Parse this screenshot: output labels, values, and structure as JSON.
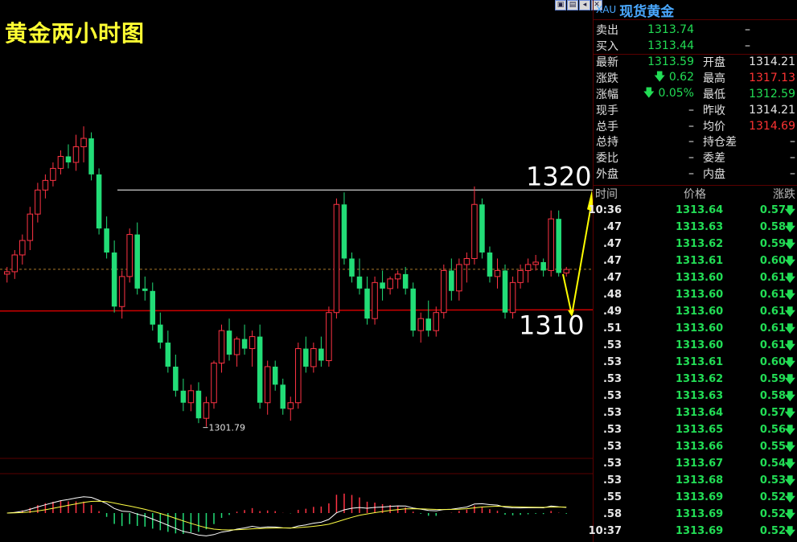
{
  "chart_title": "黄金两小时图",
  "toolbar": {
    "buttons": [
      "window-icon",
      "chart-icon",
      "back-icon",
      "close-icon"
    ]
  },
  "annotations": {
    "level_high": "1320",
    "level_low": "1310",
    "min_marker": "1301.79"
  },
  "symbol": {
    "code": "XAU",
    "name": "现货黄金"
  },
  "quotes": {
    "sell_label": "卖出",
    "sell_value": "1313.74",
    "sell_vol": "–",
    "buy_label": "买入",
    "buy_value": "1313.44",
    "buy_vol": "–",
    "rows": [
      {
        "l1": "最新",
        "v1": "1313.59",
        "c1": "grn",
        "l2": "开盘",
        "v2": "1314.21",
        "c2": "wht"
      },
      {
        "l1": "涨跌",
        "v1": "🡇 0.62",
        "c1": "grn",
        "l2": "最高",
        "v2": "1317.13",
        "c2": "red"
      },
      {
        "l1": "涨幅",
        "v1": "🡇 0.05%",
        "c1": "grn",
        "l2": "最低",
        "v2": "1312.59",
        "c2": "grn"
      },
      {
        "l1": "现手",
        "v1": "–",
        "c1": "wht",
        "l2": "昨收",
        "v2": "1314.21",
        "c2": "wht"
      },
      {
        "l1": "总手",
        "v1": "–",
        "c1": "wht",
        "l2": "均价",
        "v2": "1314.69",
        "c2": "red"
      },
      {
        "l1": "总持",
        "v1": "–",
        "c1": "wht",
        "l2": "持仓差",
        "v2": "–",
        "c2": "wht"
      },
      {
        "l1": "委比",
        "v1": "–",
        "c1": "wht",
        "l2": "委差",
        "v2": "–",
        "c2": "wht"
      },
      {
        "l1": "外盘",
        "v1": "–",
        "c1": "wht",
        "l2": "内盘",
        "v2": "–",
        "c2": "wht"
      }
    ]
  },
  "trades_header": {
    "time": "时间",
    "price": "价格",
    "change": "涨跌"
  },
  "trades": [
    {
      "time": "10:36",
      "price": "1313.64",
      "change": "0.57"
    },
    {
      "time": ".47",
      "price": "1313.63",
      "change": "0.58"
    },
    {
      "time": ".47",
      "price": "1313.62",
      "change": "0.59"
    },
    {
      "time": ".47",
      "price": "1313.61",
      "change": "0.60"
    },
    {
      "time": ".47",
      "price": "1313.60",
      "change": "0.61"
    },
    {
      "time": ".48",
      "price": "1313.60",
      "change": "0.61"
    },
    {
      "time": ".49",
      "price": "1313.60",
      "change": "0.61"
    },
    {
      "time": ".51",
      "price": "1313.60",
      "change": "0.61"
    },
    {
      "time": ".53",
      "price": "1313.60",
      "change": "0.61"
    },
    {
      "time": ".53",
      "price": "1313.61",
      "change": "0.60"
    },
    {
      "time": ".53",
      "price": "1313.62",
      "change": "0.59"
    },
    {
      "time": ".53",
      "price": "1313.63",
      "change": "0.58"
    },
    {
      "time": ".53",
      "price": "1313.64",
      "change": "0.57"
    },
    {
      "time": ".53",
      "price": "1313.65",
      "change": "0.56"
    },
    {
      "time": ".53",
      "price": "1313.66",
      "change": "0.55"
    },
    {
      "time": ".53",
      "price": "1313.67",
      "change": "0.54"
    },
    {
      "time": ".53",
      "price": "1313.68",
      "change": "0.53"
    },
    {
      "time": ".55",
      "price": "1313.69",
      "change": "0.52"
    },
    {
      "time": ".58",
      "price": "1313.69",
      "change": "0.52"
    },
    {
      "time": "10:37",
      "price": "1313.69",
      "change": "0.52"
    }
  ],
  "colors": {
    "up": "#ff3344",
    "down": "#22dd77",
    "title": "#ffff33",
    "level_high_line": "#ffffff",
    "level_low_line": "#cc0000",
    "arrow": "#ffff00",
    "dif": "#ffffff",
    "dea": "#ffff44"
  },
  "chart_data": {
    "type": "candlestick",
    "title": "黄金两小时图",
    "ylim": [
      1298,
      1332
    ],
    "reference_lines": [
      {
        "label": "1320",
        "value": 1320.2
      },
      {
        "label": "1310",
        "value": 1310.2
      },
      {
        "label": "",
        "value": 1313.6
      }
    ],
    "min_label": "1301.79",
    "ohlc": [
      [
        1313.2,
        1313.8,
        1312.5,
        1313.4
      ],
      [
        1313.4,
        1315.2,
        1312.8,
        1314.8
      ],
      [
        1314.8,
        1316.5,
        1314.0,
        1316.0
      ],
      [
        1316.0,
        1318.8,
        1315.2,
        1318.2
      ],
      [
        1318.2,
        1320.8,
        1317.5,
        1320.2
      ],
      [
        1320.2,
        1321.5,
        1319.5,
        1321.0
      ],
      [
        1321.0,
        1322.5,
        1320.5,
        1322.0
      ],
      [
        1322.0,
        1323.5,
        1321.5,
        1323.0
      ],
      [
        1323.0,
        1324.0,
        1322.0,
        1322.5
      ],
      [
        1322.5,
        1324.8,
        1321.8,
        1323.8
      ],
      [
        1323.8,
        1325.5,
        1322.5,
        1324.5
      ],
      [
        1324.5,
        1325.0,
        1321.0,
        1321.5
      ],
      [
        1321.5,
        1322.0,
        1316.5,
        1317.0
      ],
      [
        1317.0,
        1318.0,
        1314.5,
        1315.0
      ],
      [
        1315.0,
        1316.0,
        1310.0,
        1310.5
      ],
      [
        1310.5,
        1313.5,
        1309.5,
        1313.0
      ],
      [
        1313.0,
        1317.0,
        1312.5,
        1316.5
      ],
      [
        1316.5,
        1317.5,
        1311.5,
        1312.0
      ],
      [
        1312.0,
        1313.0,
        1311.0,
        1311.8
      ],
      [
        1311.8,
        1312.5,
        1308.5,
        1309.0
      ],
      [
        1309.0,
        1310.0,
        1307.0,
        1307.5
      ],
      [
        1307.5,
        1308.5,
        1305.0,
        1305.5
      ],
      [
        1305.5,
        1306.5,
        1303.0,
        1303.5
      ],
      [
        1303.5,
        1304.5,
        1301.8,
        1302.5
      ],
      [
        1302.5,
        1304.0,
        1301.79,
        1303.5
      ],
      [
        1303.5,
        1304.2,
        1300.8,
        1301.2
      ],
      [
        1301.2,
        1303.0,
        1300.5,
        1302.5
      ],
      [
        1302.5,
        1306.0,
        1302.0,
        1305.8
      ],
      [
        1305.8,
        1309.0,
        1305.0,
        1308.5
      ],
      [
        1308.5,
        1309.5,
        1306.0,
        1306.5
      ],
      [
        1306.5,
        1308.0,
        1305.5,
        1307.8
      ],
      [
        1307.8,
        1309.0,
        1306.5,
        1307.0
      ],
      [
        1307.0,
        1308.5,
        1305.5,
        1308.0
      ],
      [
        1308.0,
        1309.0,
        1302.0,
        1302.5
      ],
      [
        1302.5,
        1306.0,
        1301.5,
        1305.5
      ],
      [
        1305.5,
        1306.0,
        1303.5,
        1304.0
      ],
      [
        1304.0,
        1304.5,
        1301.5,
        1302.0
      ],
      [
        1302.0,
        1303.0,
        1301.0,
        1302.5
      ],
      [
        1302.5,
        1307.5,
        1302.0,
        1307.0
      ],
      [
        1307.0,
        1308.0,
        1305.0,
        1305.5
      ],
      [
        1305.5,
        1307.5,
        1305.0,
        1307.0
      ],
      [
        1307.0,
        1308.0,
        1305.5,
        1306.0
      ],
      [
        1306.0,
        1310.5,
        1305.5,
        1310.0
      ],
      [
        1310.0,
        1319.5,
        1309.5,
        1319.0
      ],
      [
        1319.0,
        1320.0,
        1314.0,
        1314.5
      ],
      [
        1314.5,
        1315.0,
        1312.5,
        1313.0
      ],
      [
        1313.0,
        1314.5,
        1311.5,
        1312.0
      ],
      [
        1312.0,
        1313.0,
        1309.0,
        1309.5
      ],
      [
        1309.5,
        1313.0,
        1309.0,
        1312.5
      ],
      [
        1312.5,
        1313.5,
        1311.0,
        1312.0
      ],
      [
        1312.0,
        1313.0,
        1311.5,
        1312.8
      ],
      [
        1312.8,
        1313.5,
        1312.0,
        1313.2
      ],
      [
        1313.2,
        1313.8,
        1311.5,
        1312.0
      ],
      [
        1312.0,
        1312.5,
        1308.0,
        1308.5
      ],
      [
        1308.5,
        1310.0,
        1307.5,
        1309.5
      ],
      [
        1309.5,
        1311.0,
        1308.0,
        1308.5
      ],
      [
        1308.5,
        1310.5,
        1308.0,
        1310.0
      ],
      [
        1310.0,
        1314.0,
        1309.5,
        1313.5
      ],
      [
        1313.5,
        1314.5,
        1311.0,
        1311.8
      ],
      [
        1311.8,
        1314.5,
        1311.0,
        1314.0
      ],
      [
        1314.0,
        1315.0,
        1312.5,
        1314.5
      ],
      [
        1314.5,
        1320.5,
        1314.0,
        1319.0
      ],
      [
        1319.0,
        1319.5,
        1314.5,
        1315.0
      ],
      [
        1315.0,
        1315.5,
        1312.5,
        1313.0
      ],
      [
        1313.0,
        1314.5,
        1312.0,
        1313.5
      ],
      [
        1313.5,
        1314.0,
        1309.5,
        1310.0
      ],
      [
        1310.0,
        1313.0,
        1309.5,
        1312.5
      ],
      [
        1312.5,
        1314.0,
        1312.0,
        1313.5
      ],
      [
        1313.5,
        1314.5,
        1312.5,
        1314.0
      ],
      [
        1314.0,
        1314.8,
        1313.5,
        1314.2
      ],
      [
        1314.2,
        1314.5,
        1313.0,
        1313.5
      ],
      [
        1313.5,
        1318.5,
        1313.0,
        1317.8
      ],
      [
        1317.8,
        1318.5,
        1313.0,
        1313.3
      ],
      [
        1313.3,
        1313.8,
        1313.0,
        1313.59
      ]
    ]
  }
}
